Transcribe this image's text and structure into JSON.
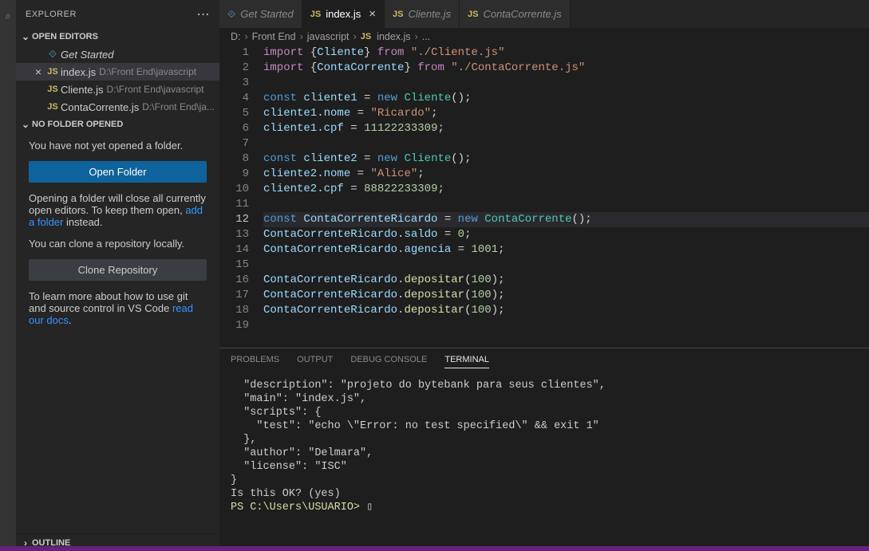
{
  "sidebar": {
    "title": "EXPLORER",
    "openEditorsLabel": "OPEN EDITORS",
    "noFolderLabel": "NO FOLDER OPENED",
    "outlineLabel": "OUTLINE",
    "editors": [
      {
        "name": "Get Started",
        "path": "",
        "icon": "vs",
        "active": false
      },
      {
        "name": "index.js",
        "path": "D:\\Front End\\javascript",
        "icon": "js",
        "active": true
      },
      {
        "name": "Cliente.js",
        "path": "D:\\Front End\\javascript",
        "icon": "js",
        "active": false
      },
      {
        "name": "ContaCorrente.js",
        "path": "D:\\Front End\\ja...",
        "icon": "js",
        "active": false
      }
    ],
    "noFolder": {
      "line1": "You have not yet opened a folder.",
      "openFolderBtn": "Open Folder",
      "line2a": "Opening a folder will close all currently open editors. To keep them open, ",
      "line2link": "add a folder",
      "line2b": " instead.",
      "line3": "You can clone a repository locally.",
      "cloneBtn": "Clone Repository",
      "line4a": "To learn more about how to use git and source control in VS Code ",
      "line4link": "read our docs",
      "line4b": "."
    }
  },
  "tabs": [
    {
      "icon": "vs",
      "label": "Get Started",
      "active": false,
      "close": false
    },
    {
      "icon": "js",
      "label": "index.js",
      "active": true,
      "close": true
    },
    {
      "icon": "js",
      "label": "Cliente.js",
      "active": false,
      "close": false
    },
    {
      "icon": "js",
      "label": "ContaCorrente.js",
      "active": false,
      "close": false
    }
  ],
  "breadcrumbs": {
    "parts": [
      "D:",
      "Front End",
      "javascript",
      "index.js",
      "..."
    ],
    "icon_index": 3
  },
  "code": {
    "active_line": 12,
    "lines": [
      [
        [
          "k-purple",
          "import "
        ],
        [
          "k-plain",
          "{"
        ],
        [
          "k-lightblue",
          "Cliente"
        ],
        [
          "k-plain",
          "} "
        ],
        [
          "k-purple",
          "from "
        ],
        [
          "k-str",
          "\"./Cliente.js\""
        ]
      ],
      [
        [
          "k-purple",
          "import "
        ],
        [
          "k-plain",
          "{"
        ],
        [
          "k-lightblue",
          "ContaCorrente"
        ],
        [
          "k-plain",
          "} "
        ],
        [
          "k-purple",
          "from "
        ],
        [
          "k-str",
          "\"./ContaCorrente.js\""
        ]
      ],
      [],
      [
        [
          "k-blue",
          "const "
        ],
        [
          "k-lightblue",
          "cliente1"
        ],
        [
          "k-plain",
          " = "
        ],
        [
          "k-blue",
          "new "
        ],
        [
          "k-type",
          "Cliente"
        ],
        [
          "k-plain",
          "();"
        ]
      ],
      [
        [
          "k-lightblue",
          "cliente1"
        ],
        [
          "k-plain",
          "."
        ],
        [
          "k-lightblue",
          "nome"
        ],
        [
          "k-plain",
          " = "
        ],
        [
          "k-str",
          "\"Ricardo\""
        ],
        [
          "k-plain",
          ";"
        ]
      ],
      [
        [
          "k-lightblue",
          "cliente1"
        ],
        [
          "k-plain",
          "."
        ],
        [
          "k-lightblue",
          "cpf"
        ],
        [
          "k-plain",
          " = "
        ],
        [
          "k-num",
          "11122233309"
        ],
        [
          "k-plain",
          ";"
        ]
      ],
      [],
      [
        [
          "k-blue",
          "const "
        ],
        [
          "k-lightblue",
          "cliente2"
        ],
        [
          "k-plain",
          " = "
        ],
        [
          "k-blue",
          "new "
        ],
        [
          "k-type",
          "Cliente"
        ],
        [
          "k-plain",
          "();"
        ]
      ],
      [
        [
          "k-lightblue",
          "cliente2"
        ],
        [
          "k-plain",
          "."
        ],
        [
          "k-lightblue",
          "nome"
        ],
        [
          "k-plain",
          " = "
        ],
        [
          "k-str",
          "\"Alice\""
        ],
        [
          "k-plain",
          ";"
        ]
      ],
      [
        [
          "k-lightblue",
          "cliente2"
        ],
        [
          "k-plain",
          "."
        ],
        [
          "k-lightblue",
          "cpf"
        ],
        [
          "k-plain",
          " = "
        ],
        [
          "k-num",
          "88822233309"
        ],
        [
          "k-plain",
          ";"
        ]
      ],
      [],
      [
        [
          "k-blue",
          "const "
        ],
        [
          "k-lightblue",
          "ContaCorrenteRicardo"
        ],
        [
          "k-plain",
          " = "
        ],
        [
          "k-blue",
          "new "
        ],
        [
          "k-type",
          "ContaCorrente"
        ],
        [
          "k-plain",
          "();"
        ]
      ],
      [
        [
          "k-lightblue",
          "ContaCorrenteRicardo"
        ],
        [
          "k-plain",
          "."
        ],
        [
          "k-lightblue",
          "saldo"
        ],
        [
          "k-plain",
          " = "
        ],
        [
          "k-num",
          "0"
        ],
        [
          "k-plain",
          ";"
        ]
      ],
      [
        [
          "k-lightblue",
          "ContaCorrenteRicardo"
        ],
        [
          "k-plain",
          "."
        ],
        [
          "k-lightblue",
          "agencia"
        ],
        [
          "k-plain",
          " = "
        ],
        [
          "k-num",
          "1001"
        ],
        [
          "k-plain",
          ";"
        ]
      ],
      [],
      [
        [
          "k-lightblue",
          "ContaCorrenteRicardo"
        ],
        [
          "k-plain",
          "."
        ],
        [
          "k-yellow",
          "depositar"
        ],
        [
          "k-plain",
          "("
        ],
        [
          "k-num",
          "100"
        ],
        [
          "k-plain",
          ");"
        ]
      ],
      [
        [
          "k-lightblue",
          "ContaCorrenteRicardo"
        ],
        [
          "k-plain",
          "."
        ],
        [
          "k-yellow",
          "depositar"
        ],
        [
          "k-plain",
          "("
        ],
        [
          "k-num",
          "100"
        ],
        [
          "k-plain",
          ");"
        ]
      ],
      [
        [
          "k-lightblue",
          "ContaCorrenteRicardo"
        ],
        [
          "k-plain",
          "."
        ],
        [
          "k-yellow",
          "depositar"
        ],
        [
          "k-plain",
          "("
        ],
        [
          "k-num",
          "100"
        ],
        [
          "k-plain",
          ");"
        ]
      ],
      []
    ]
  },
  "panel": {
    "tabs": {
      "problems": "PROBLEMS",
      "output": "OUTPUT",
      "debug": "DEBUG CONSOLE",
      "terminal": "TERMINAL"
    },
    "terminal_lines": [
      "  \"description\": \"projeto do bytebank para seus clientes\",",
      "  \"main\": \"index.js\",",
      "  \"scripts\": {",
      "    \"test\": \"echo \\\"Error: no test specified\\\" && exit 1\"",
      "  },",
      "  \"author\": \"Delmara\",",
      "  \"license\": \"ISC\"",
      "}",
      "",
      "Is this OK? (yes)"
    ],
    "prompt": "PS C:\\Users\\USUARIO> "
  }
}
